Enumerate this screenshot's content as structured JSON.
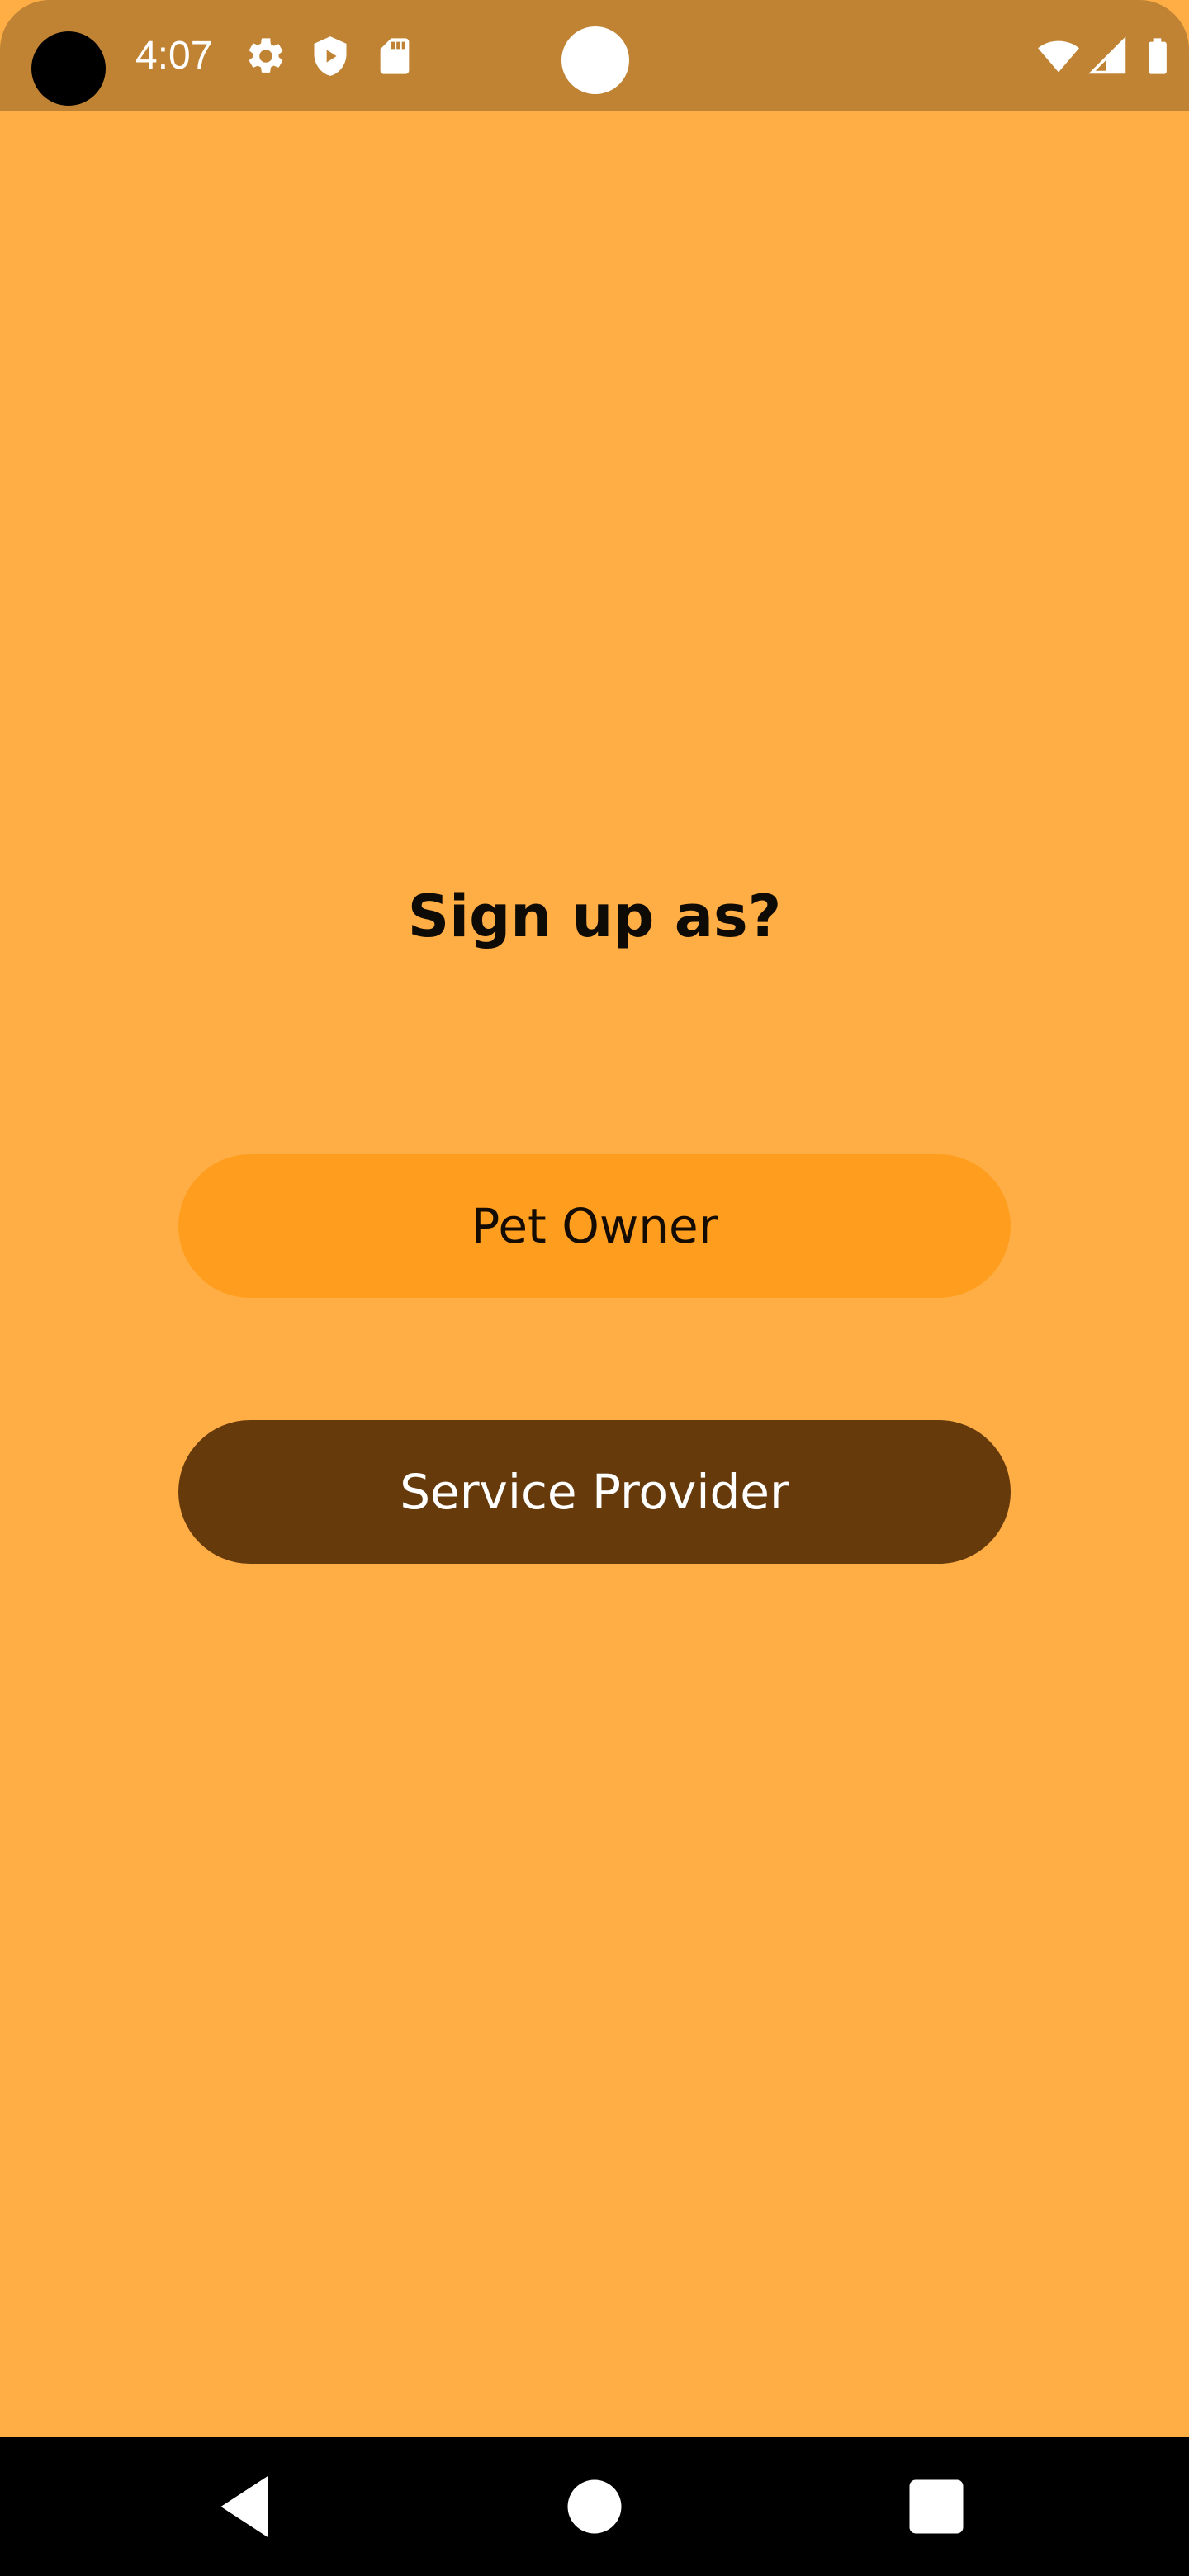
{
  "status_bar": {
    "time": "4:07",
    "left_icons": [
      "gear-icon",
      "shield-icon",
      "sd-card-icon"
    ],
    "right_icons": [
      "wifi-icon",
      "signal-icon",
      "battery-icon"
    ]
  },
  "main": {
    "title": "Sign up as?",
    "buttons": [
      {
        "label": "Pet Owner",
        "color": "#FF9E1E",
        "text_color": "#140C02"
      },
      {
        "label": "Service Provider",
        "color": "#663A0B",
        "text_color": "#FFFFFF"
      }
    ]
  },
  "nav_bar": {
    "items": [
      "back-icon",
      "home-icon",
      "recents-icon"
    ]
  },
  "colors": {
    "background": "#FFAE45",
    "status_bar": "#C08334",
    "nav_bar": "#000000"
  }
}
